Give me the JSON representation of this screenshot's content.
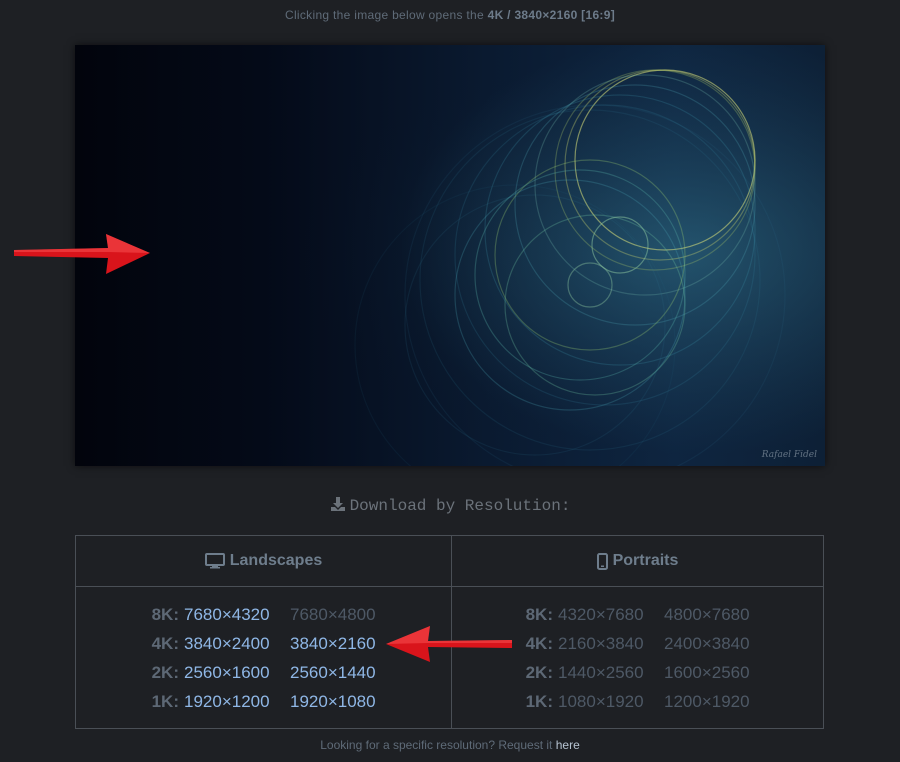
{
  "notice": {
    "prefix": "Clicking the image below opens the",
    "resolution": "4K / 3840×2160 [16:9]"
  },
  "download": {
    "heading": "Download by Resolution:",
    "icon": "download-icon"
  },
  "landscapes": {
    "header": "Landscapes",
    "icon": "monitor-icon",
    "rows": [
      {
        "tier": "8K:",
        "a": "7680×4320",
        "b": "7680×4800"
      },
      {
        "tier": "4K:",
        "a": "3840×2400",
        "b": "3840×2160"
      },
      {
        "tier": "2K:",
        "a": "2560×1600",
        "b": "2560×1440"
      },
      {
        "tier": "1K:",
        "a": "1920×1200",
        "b": "1920×1080"
      }
    ]
  },
  "portraits": {
    "header": "Portraits",
    "icon": "phone-icon",
    "rows": [
      {
        "tier": "8K:",
        "a": "4320×7680",
        "b": "4800×7680"
      },
      {
        "tier": "4K:",
        "a": "2160×3840",
        "b": "2400×3840"
      },
      {
        "tier": "2K:",
        "a": "1440×2560",
        "b": "1600×2560"
      },
      {
        "tier": "1K:",
        "a": "1080×1920",
        "b": "1200×1920"
      }
    ]
  },
  "footer": {
    "text": "Looking for a specific resolution? Request it",
    "link": "here"
  },
  "colors": {
    "background": "#1e2024",
    "link": "#8fb7e6",
    "muted": "#4e5966",
    "arrow": "#d9141b"
  },
  "preview": {
    "signature": "Rafael Fidel"
  }
}
